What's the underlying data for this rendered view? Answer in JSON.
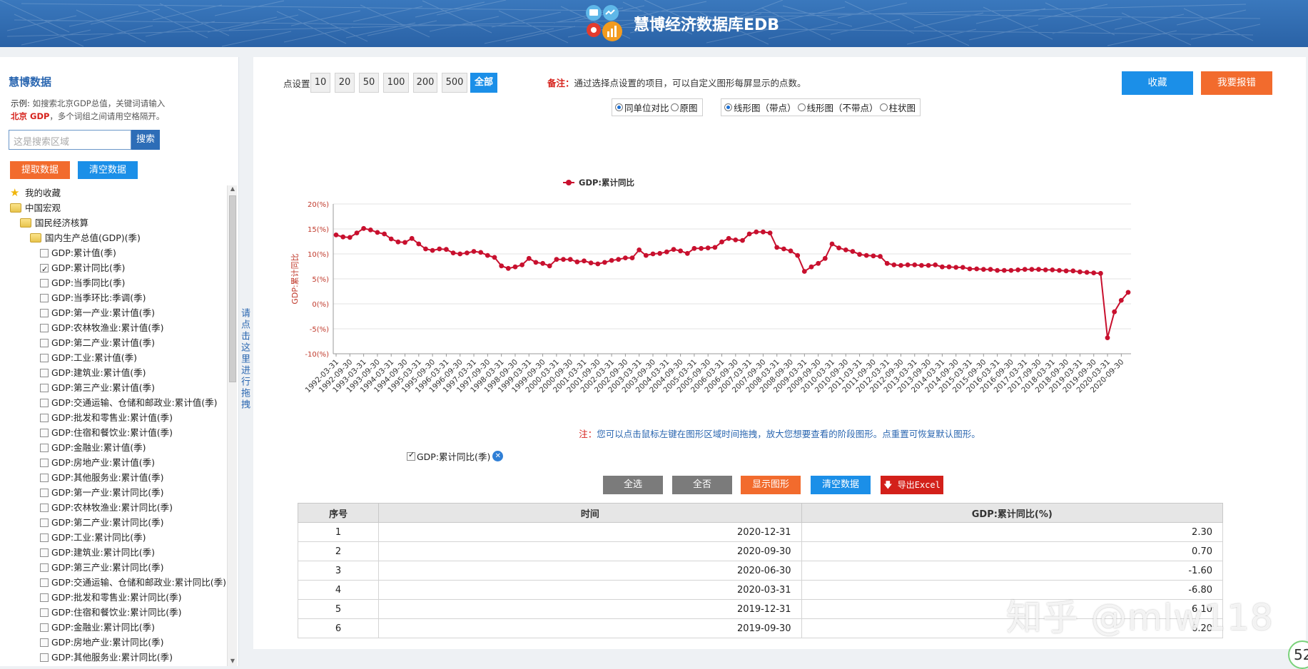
{
  "header": {
    "title": "慧博经济数据库EDB"
  },
  "sidebar": {
    "title": "慧博数据",
    "example_label": "示例:",
    "example_text1": "如搜索北京GDP总值，关键词请输入",
    "example_red": "北京 GDP",
    "example_text2": "，多个词组之间请用空格隔开。",
    "search_placeholder": "这是搜索区域",
    "search_button": "搜索",
    "fetch_button": "提取数据",
    "clear_button": "清空数据",
    "tree": [
      {
        "label": "我的收藏",
        "type": "star",
        "indent": 0
      },
      {
        "label": "中国宏观",
        "type": "folder",
        "indent": 0
      },
      {
        "label": "国民经济核算",
        "type": "folder",
        "indent": 1
      },
      {
        "label": "国内生产总值(GDP)(季)",
        "type": "folder",
        "indent": 2
      },
      {
        "label": "GDP:累计值(季)",
        "type": "check",
        "checked": false
      },
      {
        "label": "GDP:累计同比(季)",
        "type": "check",
        "checked": true
      },
      {
        "label": "GDP:当季同比(季)",
        "type": "check",
        "checked": false
      },
      {
        "label": "GDP:当季环比:季调(季)",
        "type": "check",
        "checked": false
      },
      {
        "label": "GDP:第一产业:累计值(季)",
        "type": "check",
        "checked": false
      },
      {
        "label": "GDP:农林牧渔业:累计值(季)",
        "type": "check",
        "checked": false
      },
      {
        "label": "GDP:第二产业:累计值(季)",
        "type": "check",
        "checked": false
      },
      {
        "label": "GDP:工业:累计值(季)",
        "type": "check",
        "checked": false
      },
      {
        "label": "GDP:建筑业:累计值(季)",
        "type": "check",
        "checked": false
      },
      {
        "label": "GDP:第三产业:累计值(季)",
        "type": "check",
        "checked": false
      },
      {
        "label": "GDP:交通运输、仓储和邮政业:累计值(季)",
        "type": "check",
        "checked": false
      },
      {
        "label": "GDP:批发和零售业:累计值(季)",
        "type": "check",
        "checked": false
      },
      {
        "label": "GDP:住宿和餐饮业:累计值(季)",
        "type": "check",
        "checked": false
      },
      {
        "label": "GDP:金融业:累计值(季)",
        "type": "check",
        "checked": false
      },
      {
        "label": "GDP:房地产业:累计值(季)",
        "type": "check",
        "checked": false
      },
      {
        "label": "GDP:其他服务业:累计值(季)",
        "type": "check",
        "checked": false
      },
      {
        "label": "GDP:第一产业:累计同比(季)",
        "type": "check",
        "checked": false
      },
      {
        "label": "GDP:农林牧渔业:累计同比(季)",
        "type": "check",
        "checked": false
      },
      {
        "label": "GDP:第二产业:累计同比(季)",
        "type": "check",
        "checked": false
      },
      {
        "label": "GDP:工业:累计同比(季)",
        "type": "check",
        "checked": false
      },
      {
        "label": "GDP:建筑业:累计同比(季)",
        "type": "check",
        "checked": false
      },
      {
        "label": "GDP:第三产业:累计同比(季)",
        "type": "check",
        "checked": false
      },
      {
        "label": "GDP:交通运输、仓储和邮政业:累计同比(季)",
        "type": "check",
        "checked": false
      },
      {
        "label": "GDP:批发和零售业:累计同比(季)",
        "type": "check",
        "checked": false
      },
      {
        "label": "GDP:住宿和餐饮业:累计同比(季)",
        "type": "check",
        "checked": false
      },
      {
        "label": "GDP:金融业:累计同比(季)",
        "type": "check",
        "checked": false
      },
      {
        "label": "GDP:房地产业:累计同比(季)",
        "type": "check",
        "checked": false
      },
      {
        "label": "GDP:其他服务业:累计同比(季)",
        "type": "check",
        "checked": false
      }
    ]
  },
  "drag_tip": "请点击这里进行拖拽",
  "toolbar": {
    "points_label": "点设置:",
    "points": [
      "10",
      "20",
      "50",
      "100",
      "200",
      "500",
      "全部"
    ],
    "active_point": "全部",
    "note_label": "备注：",
    "note_text": "通过选择点设置的项目，可以自定义图形每屏显示的点数。",
    "fav_button": "收藏",
    "report_button": "我要报错",
    "mode_options": [
      {
        "label": "同单位对比",
        "on": true
      },
      {
        "label": "原图",
        "on": false
      }
    ],
    "type_options": [
      {
        "label": "线形图（带点）",
        "on": true
      },
      {
        "label": "线形图（不带点）",
        "on": false
      },
      {
        "label": "柱状图",
        "on": false
      }
    ]
  },
  "chart_data": {
    "type": "line",
    "title": "",
    "legend": [
      "GDP:累计同比"
    ],
    "legend_position": "top-center",
    "ylabel": "GDP:累计同比",
    "ylim": [
      -10,
      20
    ],
    "yticks": [
      "20(%)",
      "15(%)",
      "10(%)",
      "5(%)",
      "0(%)",
      "-5(%)",
      "-10(%)"
    ],
    "grid": true,
    "x_start": "1992-03-31",
    "x_end": "2020-12-31",
    "xtick_labels": [
      "1992-03-31",
      "1992-09-30",
      "1993-03-31",
      "1993-09-30",
      "1994-03-31",
      "1994-09-30",
      "1995-03-31",
      "1995-09-30",
      "1996-03-31",
      "1996-09-30",
      "1997-03-31",
      "1997-09-30",
      "1998-03-31",
      "1998-09-30",
      "1999-03-31",
      "1999-09-30",
      "2000-03-31",
      "2000-09-30",
      "2001-03-31",
      "2001-09-30",
      "2002-03-31",
      "2002-09-30",
      "2003-03-31",
      "2003-09-30",
      "2004-03-31",
      "2004-09-30",
      "2005-03-31",
      "2005-09-30",
      "2006-03-31",
      "2006-09-30",
      "2007-03-31",
      "2007-09-30",
      "2008-03-31",
      "2008-09-30",
      "2009-03-31",
      "2009-09-30",
      "2010-03-31",
      "2010-09-30",
      "2011-03-31",
      "2011-09-30",
      "2012-03-31",
      "2012-09-30",
      "2013-03-31",
      "2013-09-30",
      "2014-03-31",
      "2014-09-30",
      "2015-03-31",
      "2015-09-30",
      "2016-03-31",
      "2016-09-30",
      "2017-03-31",
      "2017-09-30",
      "2018-03-31",
      "2018-09-30",
      "2019-03-31",
      "2019-09-30",
      "2020-03-31",
      "2020-09-30"
    ],
    "series": [
      {
        "name": "GDP:累计同比",
        "color": "#c8102e",
        "values": [
          13.8,
          13.4,
          13.3,
          14.2,
          15.1,
          14.8,
          14.3,
          14.0,
          13.0,
          12.4,
          12.3,
          13.1,
          12.0,
          11.0,
          10.7,
          11.0,
          10.9,
          10.2,
          10.0,
          10.2,
          10.5,
          10.3,
          9.7,
          9.3,
          7.6,
          7.1,
          7.4,
          7.8,
          9.1,
          8.3,
          8.1,
          7.6,
          8.9,
          8.9,
          8.9,
          8.4,
          8.6,
          8.2,
          8.0,
          8.3,
          8.7,
          8.9,
          9.2,
          9.2,
          10.8,
          9.7,
          10.0,
          10.1,
          10.4,
          10.9,
          10.6,
          10.1,
          11.1,
          11.1,
          11.2,
          11.3,
          12.4,
          13.1,
          12.8,
          12.7,
          14.0,
          14.4,
          14.4,
          14.2,
          11.3,
          11.0,
          10.6,
          9.7,
          6.5,
          7.4,
          8.1,
          9.1,
          12.0,
          11.2,
          10.8,
          10.5,
          9.9,
          9.7,
          9.6,
          9.5,
          8.1,
          7.8,
          7.7,
          7.8,
          7.8,
          7.7,
          7.7,
          7.8,
          7.4,
          7.4,
          7.3,
          7.3,
          7.0,
          7.0,
          6.9,
          6.9,
          6.7,
          6.7,
          6.7,
          6.8,
          6.9,
          6.9,
          6.9,
          6.8,
          6.8,
          6.7,
          6.6,
          6.6,
          6.4,
          6.3,
          6.2,
          6.1,
          -6.8,
          -1.6,
          0.7,
          2.3
        ]
      }
    ]
  },
  "chart_note": {
    "label": "注：",
    "text": "您可以点击鼠标左键在图形区域时间拖拽，放大您想要查看的阶段图形。点重置可恢复默认图形。"
  },
  "series_checkbox": "GDP:累计同比(季)",
  "actions": {
    "select_all": "全选",
    "select_none": "全否",
    "show_chart": "显示图形",
    "clear_data": "清空数据",
    "export_excel": "导出Excel"
  },
  "table": {
    "headers": [
      "序号",
      "时间",
      "GDP:累计同比(%)"
    ],
    "rows": [
      [
        "1",
        "2020-12-31",
        "2.30"
      ],
      [
        "2",
        "2020-09-30",
        "0.70"
      ],
      [
        "3",
        "2020-06-30",
        "-1.60"
      ],
      [
        "4",
        "2020-03-31",
        "-6.80"
      ],
      [
        "5",
        "2019-12-31",
        "6.10"
      ],
      [
        "6",
        "2019-09-30",
        "6.20"
      ]
    ]
  },
  "watermark": "知乎 @mlw118",
  "corner_badge": "52"
}
